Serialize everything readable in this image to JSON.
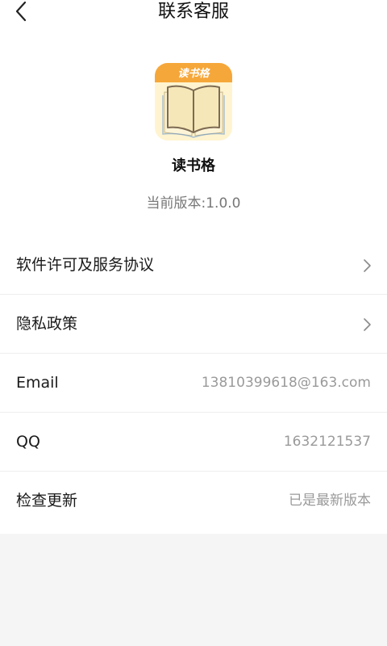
{
  "header": {
    "title": "联系客服",
    "back_icon": "chevron-left-icon"
  },
  "app": {
    "logo_label": "读书格",
    "name": "读书格",
    "version": "当前版本:1.0.0",
    "logo_colors": {
      "top_bar": "#f6a73a",
      "background": "#fff2c8",
      "book": "#f2e3b0",
      "outline": "#7a6a55"
    }
  },
  "rows": [
    {
      "label": "软件许可及服务协议",
      "value": "",
      "chevron": true
    },
    {
      "label": "隐私政策",
      "value": "",
      "chevron": true
    },
    {
      "label": "Email",
      "value": "13810399618@163.com",
      "chevron": false
    },
    {
      "label": "QQ",
      "value": "1632121537",
      "chevron": false
    },
    {
      "label": "检查更新",
      "value": "已是最新版本",
      "chevron": false
    }
  ],
  "colors": {
    "page_background": "#f5f5f5",
    "card_background": "#ffffff",
    "secondary_text": "#9a9a9a"
  }
}
